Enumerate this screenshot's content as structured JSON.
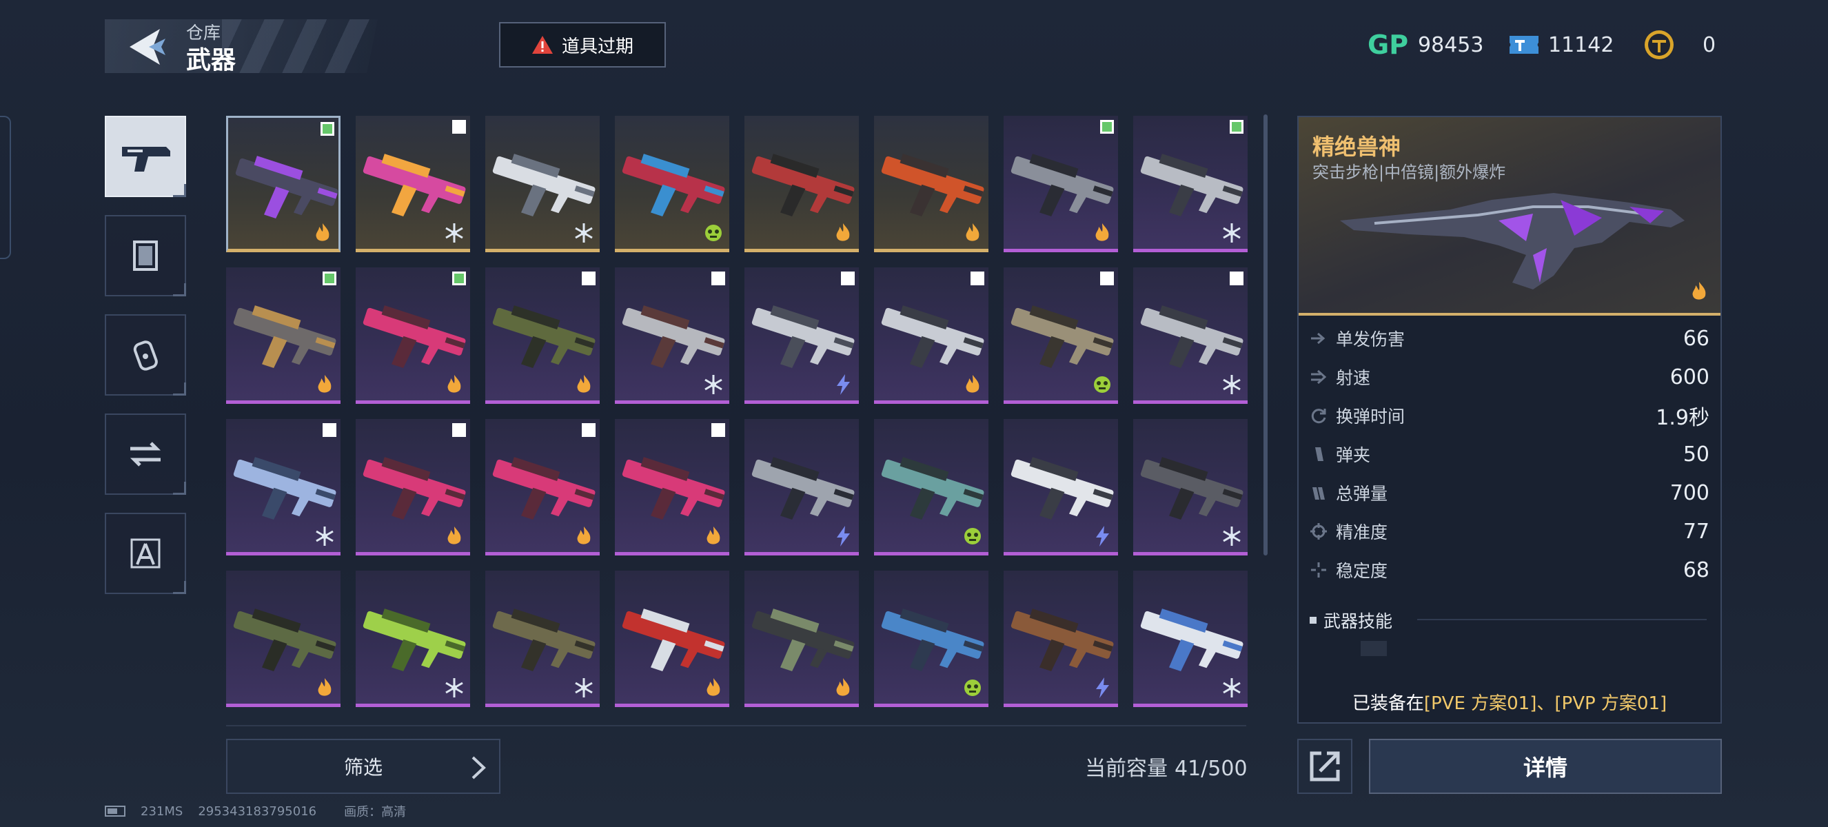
{
  "header": {
    "breadcrumb_parent": "仓库",
    "title": "武器",
    "expire_button_label": "道具过期"
  },
  "currencies": [
    {
      "icon": "gp-icon",
      "value": "98453"
    },
    {
      "icon": "ticket-icon",
      "value": "11142"
    },
    {
      "icon": "coin-icon",
      "value": "0"
    }
  ],
  "categories": [
    {
      "icon": "pistol-icon",
      "active": true
    },
    {
      "icon": "skin-frame-icon",
      "active": false
    },
    {
      "icon": "grenade-icon",
      "active": false
    },
    {
      "icon": "swap-icon",
      "active": false
    },
    {
      "icon": "compass-icon",
      "active": false
    }
  ],
  "weapon_grid": [
    {
      "rarity": "gold",
      "weapon": "purple-rifle",
      "checkbox": "checked",
      "element": "fire",
      "selected": true
    },
    {
      "rarity": "gold",
      "weapon": "pink-smg",
      "checkbox": "unchecked",
      "element": "ice"
    },
    {
      "rarity": "gold",
      "weapon": "white-shotgun",
      "checkbox": "none",
      "element": "ice"
    },
    {
      "rarity": "gold",
      "weapon": "red-launcher",
      "checkbox": "none",
      "element": "toxic"
    },
    {
      "rarity": "gold",
      "weapon": "red-minigun",
      "checkbox": "none",
      "element": "fire"
    },
    {
      "rarity": "gold",
      "weapon": "orange-minigun",
      "checkbox": "none",
      "element": "fire"
    },
    {
      "rarity": "purple",
      "weapon": "grey-pistol",
      "checkbox": "checked",
      "element": "fire"
    },
    {
      "rarity": "purple",
      "weapon": "crossbow",
      "checkbox": "checked",
      "element": "ice"
    },
    {
      "rarity": "purple",
      "weapon": "knife",
      "checkbox": "checked",
      "element": "fire"
    },
    {
      "rarity": "purple",
      "weapon": "pink-dagger",
      "checkbox": "checked",
      "element": "fire"
    },
    {
      "rarity": "purple",
      "weapon": "camo-rifle",
      "checkbox": "unchecked",
      "element": "fire"
    },
    {
      "rarity": "purple",
      "weapon": "grey-rifle",
      "checkbox": "unchecked",
      "element": "ice"
    },
    {
      "rarity": "purple",
      "weapon": "silver-launcher",
      "checkbox": "unchecked",
      "element": "lightning"
    },
    {
      "rarity": "purple",
      "weapon": "silver-pistol",
      "checkbox": "unchecked",
      "element": "fire"
    },
    {
      "rarity": "purple",
      "weapon": "gold-pistol",
      "checkbox": "unchecked",
      "element": "toxic"
    },
    {
      "rarity": "purple",
      "weapon": "crossbow",
      "checkbox": "unchecked",
      "element": "ice"
    },
    {
      "rarity": "purple",
      "weapon": "blue-crossbow",
      "checkbox": "unchecked",
      "element": "ice"
    },
    {
      "rarity": "purple",
      "weapon": "pink-dagger",
      "checkbox": "unchecked",
      "element": "fire"
    },
    {
      "rarity": "purple",
      "weapon": "pink-dagger",
      "checkbox": "unchecked",
      "element": "fire"
    },
    {
      "rarity": "purple",
      "weapon": "pink-dagger",
      "checkbox": "unchecked",
      "element": "fire"
    },
    {
      "rarity": "purple",
      "weapon": "grey-sniper",
      "checkbox": "none",
      "element": "lightning"
    },
    {
      "rarity": "purple",
      "weapon": "teal-rifle",
      "checkbox": "none",
      "element": "toxic"
    },
    {
      "rarity": "purple",
      "weapon": "white-smg",
      "checkbox": "none",
      "element": "lightning"
    },
    {
      "rarity": "purple",
      "weapon": "dark-smg",
      "checkbox": "none",
      "element": "ice"
    },
    {
      "rarity": "purple",
      "weapon": "camo-smg",
      "checkbox": "none",
      "element": "fire"
    },
    {
      "rarity": "purple",
      "weapon": "green-smg",
      "checkbox": "none",
      "element": "ice"
    },
    {
      "rarity": "purple",
      "weapon": "olive-smg",
      "checkbox": "none",
      "element": "ice"
    },
    {
      "rarity": "purple",
      "weapon": "red-smg",
      "checkbox": "none",
      "element": "fire"
    },
    {
      "rarity": "purple",
      "weapon": "black-launcher",
      "checkbox": "none",
      "element": "fire"
    },
    {
      "rarity": "purple",
      "weapon": "blue-rifle",
      "checkbox": "none",
      "element": "toxic"
    },
    {
      "rarity": "purple",
      "weapon": "bronze-pistol",
      "checkbox": "none",
      "element": "lightning"
    },
    {
      "rarity": "purple",
      "weapon": "white-blaster",
      "checkbox": "none",
      "element": "ice"
    }
  ],
  "detail": {
    "name": "精绝兽神",
    "tags": "突击步枪|中倍镜|额外爆炸",
    "stats": [
      {
        "icon": "damage-icon",
        "label": "单发伤害",
        "value": "66"
      },
      {
        "icon": "fire-rate-icon",
        "label": "射速",
        "value": "600"
      },
      {
        "icon": "reload-icon",
        "label": "换弹时间",
        "value": "1.9秒"
      },
      {
        "icon": "magazine-icon",
        "label": "弹夹",
        "value": "50"
      },
      {
        "icon": "total-ammo-icon",
        "label": "总弹量",
        "value": "700"
      },
      {
        "icon": "accuracy-icon",
        "label": "精准度",
        "value": "77"
      },
      {
        "icon": "stability-icon",
        "label": "稳定度",
        "value": "68"
      }
    ],
    "skills_title": "武器技能",
    "equipped_prefix": "已装备在",
    "equipped_loadouts": "[PVE 方案01]、[PVP 方案01]"
  },
  "bottom": {
    "filter_label": "筛选",
    "capacity_label": "当前容量",
    "capacity_value": "41/500",
    "detail_button_label": "详情"
  },
  "footer": {
    "ping": "231MS",
    "uid": "295343183795016",
    "quality": "画质：高清"
  },
  "colors": {
    "gold_rarity": "#d4b06a",
    "purple_rarity": "#b35fd6",
    "highlight_text": "#f2c96a",
    "check_green": "#66c76a"
  }
}
